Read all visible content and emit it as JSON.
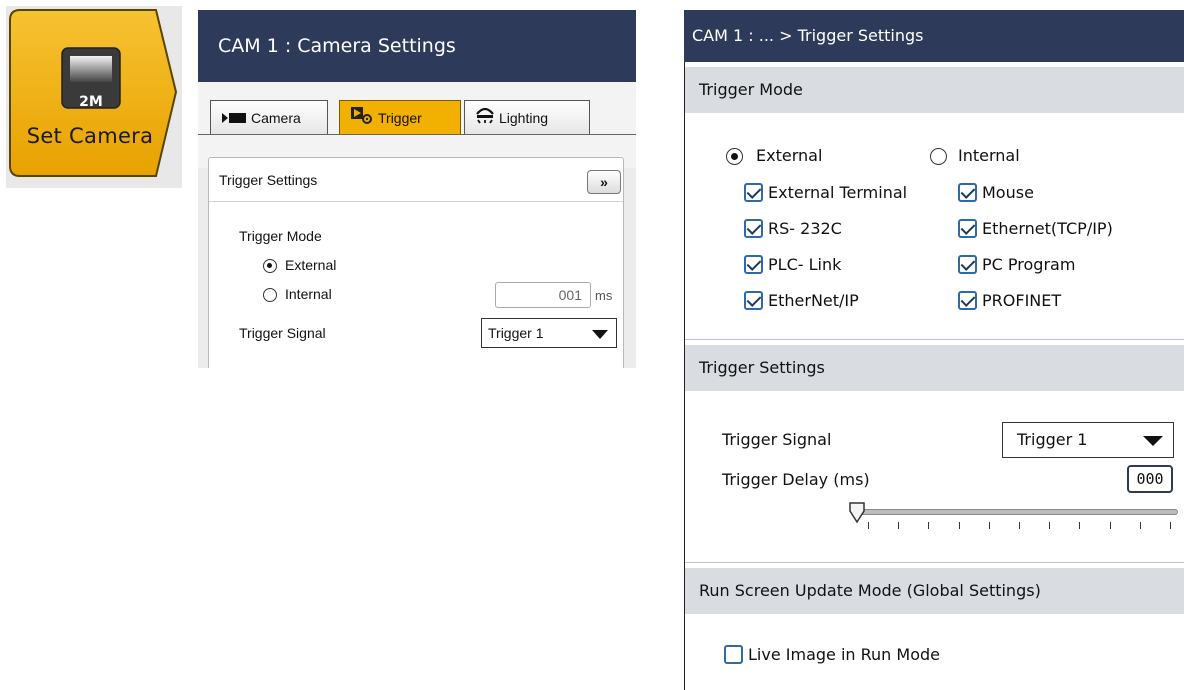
{
  "set_camera": {
    "label": "Set Camera",
    "badge": "2M",
    "colors": {
      "accent": "#f2b000",
      "border": "#6b5000"
    }
  },
  "middle": {
    "title": "CAM 1 : Camera Settings",
    "tabs": [
      {
        "label": "Camera",
        "icon": "camera-icon"
      },
      {
        "label": "Trigger",
        "icon": "trigger-icon"
      },
      {
        "label": "Lighting",
        "icon": "lighting-icon"
      }
    ],
    "active_tab": "Trigger",
    "section_title": "Trigger Settings",
    "expand_glyph": "»",
    "trigger_mode_label": "Trigger Mode",
    "mode_options": [
      "External",
      "Internal"
    ],
    "selected_mode": "External",
    "interval_value": "001",
    "interval_unit": "ms",
    "trigger_signal_label": "Trigger Signal",
    "trigger_signal_value": "Trigger 1"
  },
  "right": {
    "title": "CAM 1 : ... > Trigger Settings",
    "trigger_mode": {
      "header": "Trigger Mode",
      "options": [
        "External",
        "Internal"
      ],
      "selected": "External",
      "sources": [
        {
          "label": "External Terminal",
          "checked": true
        },
        {
          "label": "Mouse",
          "checked": true
        },
        {
          "label": "RS- 232C",
          "checked": true
        },
        {
          "label": "Ethernet(TCP/IP)",
          "checked": true
        },
        {
          "label": "PLC- Link",
          "checked": true
        },
        {
          "label": "PC Program",
          "checked": true
        },
        {
          "label": "EtherNet/IP",
          "checked": true
        },
        {
          "label": "PROFINET",
          "checked": true
        }
      ]
    },
    "trigger_settings": {
      "header": "Trigger Settings",
      "signal_label": "Trigger Signal",
      "signal_value": "Trigger 1",
      "delay_label": "Trigger Delay (ms)",
      "delay_value": "000",
      "slider_level": 0
    },
    "run_screen": {
      "header": "Run Screen Update Mode (Global Settings)",
      "live_image_label": "Live Image in Run Mode",
      "live_image_checked": false
    },
    "colors": {
      "title_bar": "#2e3a5a",
      "section_bg": "#d9dde2",
      "checkbox": "#2f6aa8"
    }
  }
}
